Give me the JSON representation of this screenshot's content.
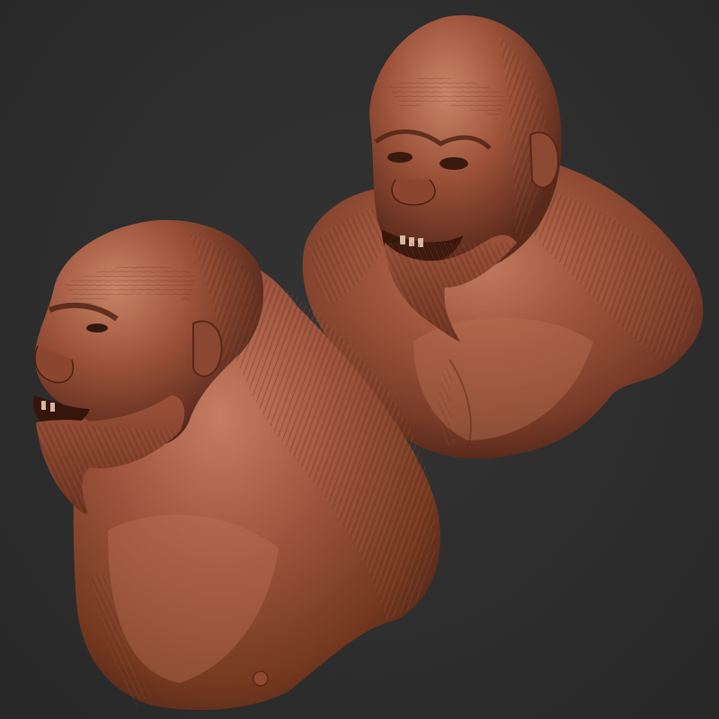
{
  "scene": {
    "background_color": "#2e2e2e",
    "material_color": "#8a4a36",
    "material_highlight": "#b86e55",
    "material_shadow": "#4a2418",
    "subject": "ape-creature-sculpt",
    "views": [
      {
        "id": "three-quarter-view",
        "description_icon": "ape-bust-three-quarter"
      },
      {
        "id": "profile-view",
        "description_icon": "ape-bust-profile"
      }
    ]
  }
}
